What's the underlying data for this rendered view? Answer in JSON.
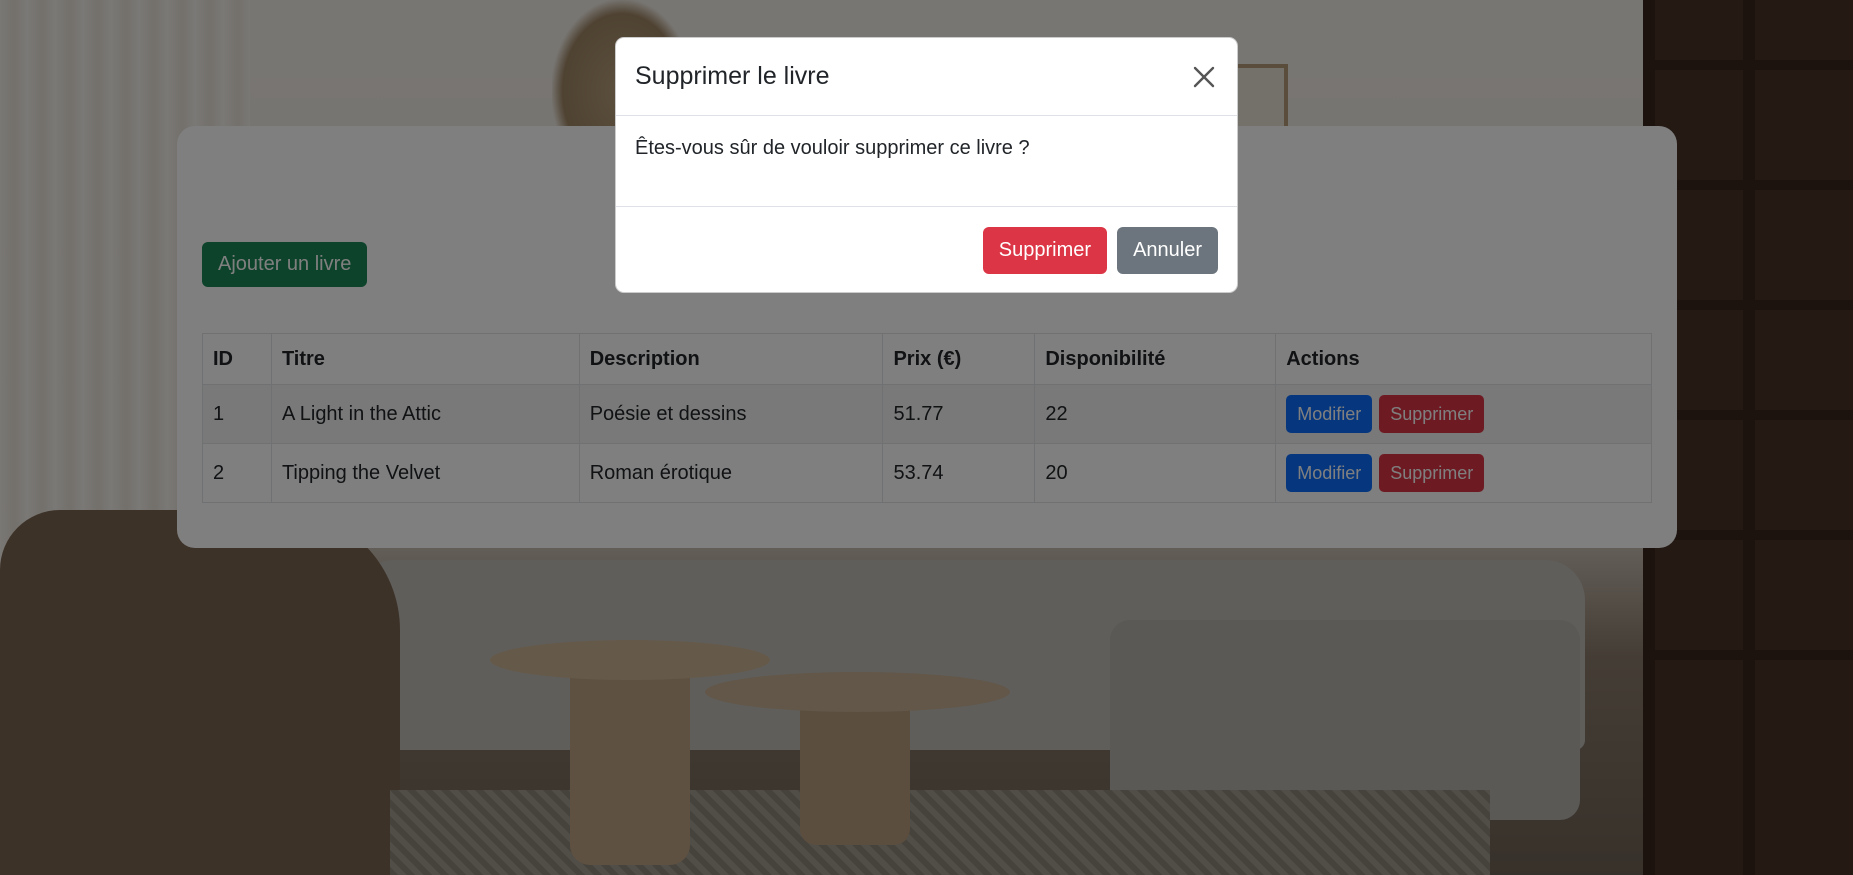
{
  "modal": {
    "title": "Supprimer le livre",
    "message": "Êtes-vous sûr de vouloir supprimer ce livre ?",
    "confirm_label": "Supprimer",
    "cancel_label": "Annuler",
    "close_icon": "close-icon"
  },
  "page": {
    "add_button_label": "Ajouter un livre"
  },
  "table": {
    "headers": {
      "id": "ID",
      "title": "Titre",
      "description": "Description",
      "price": "Prix (€)",
      "availability": "Disponibilité",
      "actions": "Actions"
    },
    "rows": [
      {
        "id": "1",
        "title": "A Light in the Attic",
        "description": "Poésie et dessins",
        "price": "51.77",
        "availability": "22",
        "edit_label": "Modifier",
        "delete_label": "Supprimer"
      },
      {
        "id": "2",
        "title": "Tipping the Velvet",
        "description": "Roman érotique",
        "price": "53.74",
        "availability": "20",
        "edit_label": "Modifier",
        "delete_label": "Supprimer"
      }
    ]
  },
  "colors": {
    "success": "#198754",
    "primary": "#0d6efd",
    "danger": "#dc3545",
    "secondary": "#6c757d"
  }
}
